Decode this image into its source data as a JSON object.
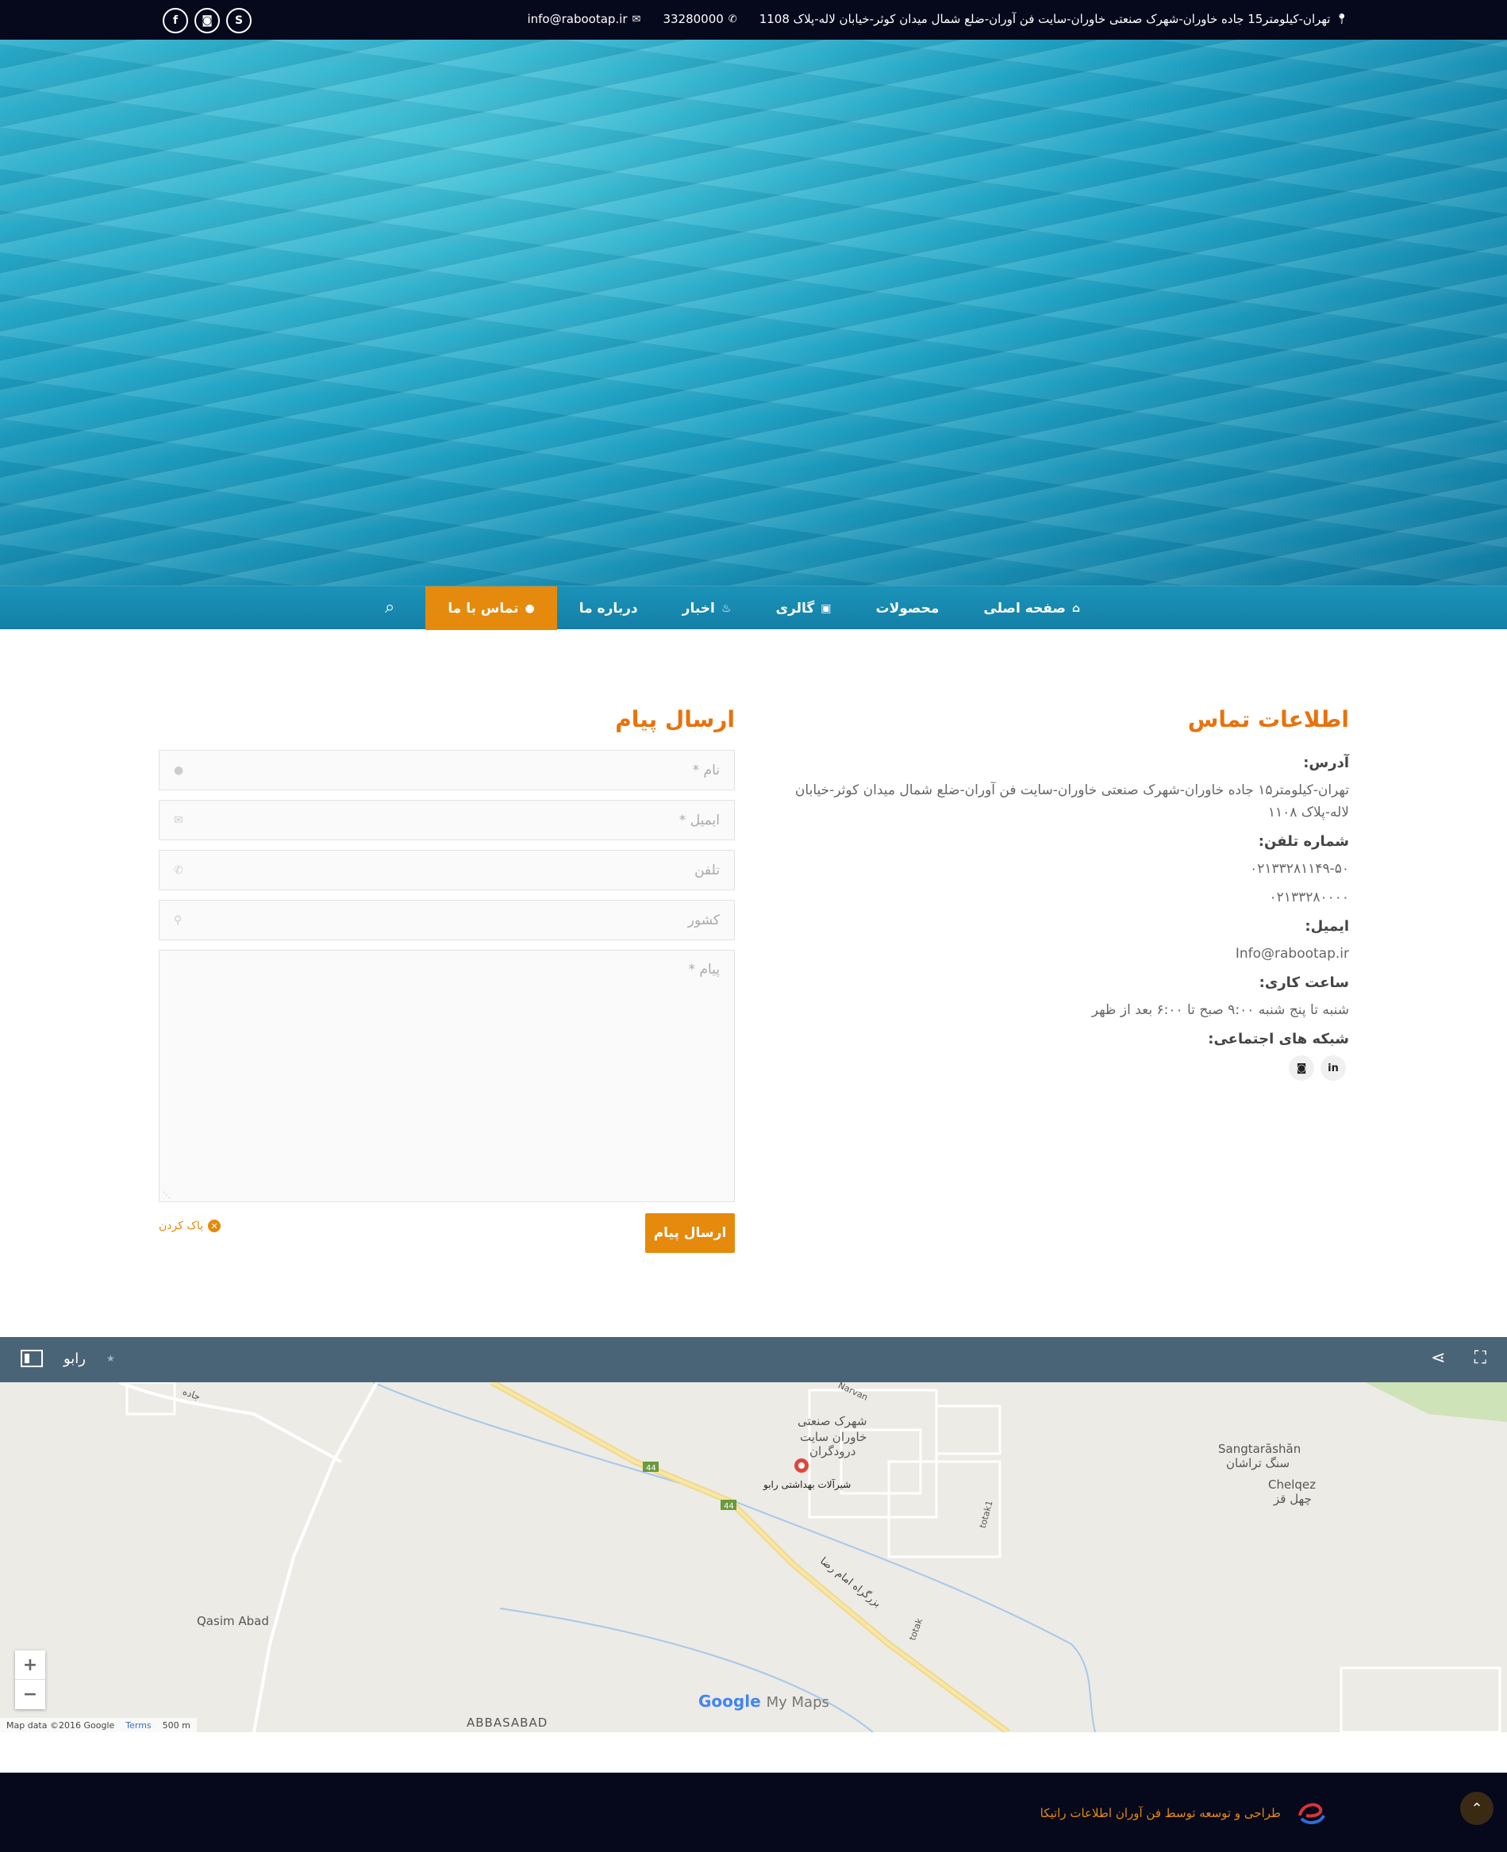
{
  "topbar": {
    "address": "تهران-کیلومتر15 جاده خاوران-شهرک صنعتی خاوران-سایت فن آوران-ضلع شمال میدان کوثر-خیابان لاله-پلاک 1108",
    "phone": "33280000",
    "email": "info@rabootap.ir",
    "social_icons": [
      "facebook-icon",
      "instagram-icon",
      "skype-icon"
    ]
  },
  "nav": {
    "items": [
      {
        "label": "صفحه اصلی",
        "icon": "home-icon"
      },
      {
        "label": "محصولات",
        "icon": ""
      },
      {
        "label": "گالری",
        "icon": "camera-icon"
      },
      {
        "label": "اخبار",
        "icon": "news-icon"
      },
      {
        "label": "درباره ما",
        "icon": ""
      },
      {
        "label": "تماس با ما",
        "icon": "user-icon",
        "active": true
      }
    ]
  },
  "contact": {
    "title": "اطلاعات تماس",
    "address_label": "آدرس:",
    "address_value": "تهران-کیلومتر۱۵ جاده خاوران-شهرک صنعتی خاوران-سایت فن آوران-ضلع شمال میدان کوثر-خیابان لاله-پلاک ۱۱۰۸",
    "phone_label": "شماره تلفن:",
    "phone_1": "۰۲۱۳۳۲۸۱۱۴۹-۵۰",
    "phone_2": "۰۲۱۳۳۲۸۰۰۰۰",
    "email_label": "ایمیل:",
    "email_value": "Info@rabootap.ir",
    "hours_label": "ساعت کاری:",
    "hours_value": "شنبه تا پنج شنبه ۹:۰۰ صبح تا ۶:۰۰ بعد از ظهر",
    "social_label": "شبکه های اجتماعی:"
  },
  "form": {
    "title": "ارسال پیام",
    "name_placeholder": "نام *",
    "email_placeholder": "ایمیل *",
    "phone_placeholder": "تلفن",
    "country_placeholder": "کشور",
    "message_placeholder": "پیام *",
    "submit_label": "ارسال پیام",
    "clear_label": "پاک کردن"
  },
  "map": {
    "title": "رابو",
    "labels": {
      "industrial": "شهرک صنعتی",
      "khavaran": "خاوران سایت",
      "drodgaran": "درودگران",
      "company": "شیرآلات بهداشتی رابو",
      "sangtarashan_en": "Sangtarāshān",
      "sangtarashan_fa": "سنگ تراشان",
      "chelqez_en": "Chelqez",
      "chelqez_fa": "چهل قز",
      "qasim": "Qasim Abad",
      "abbasabad": "ABBASABAD",
      "highway": "بزرگراه امام رضا",
      "road_44": "44",
      "road_jade": "جاده",
      "totak": "totak",
      "totak1": "totak1",
      "narvan": "Narvan"
    },
    "attribution": "Map data ©2016 Google",
    "terms": "Terms",
    "scale": "500 m",
    "brand_google": "Google",
    "brand_mymaps": "My Maps"
  },
  "footer": {
    "text": "طراحی و توسعه توسط فن آوران اطلاعات راتیکا"
  }
}
